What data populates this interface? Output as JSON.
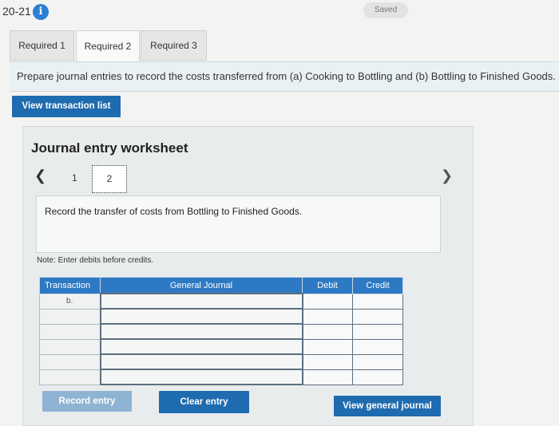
{
  "header": {
    "question_number": "20-21",
    "saved_label": "Saved"
  },
  "tabs": [
    {
      "label": "Required 1",
      "active": false
    },
    {
      "label": "Required 2",
      "active": true
    },
    {
      "label": "Required 3",
      "active": false
    }
  ],
  "instruction": "Prepare journal entries to record the costs transferred from (a) Cooking to Bottling and (b) Bottling to Finished Goods.",
  "view_transaction_list_label": "View transaction list",
  "worksheet": {
    "title": "Journal entry worksheet",
    "pages": [
      "1",
      "2"
    ],
    "current_page": "2",
    "description": "Record the transfer of costs from Bottling to Finished Goods.",
    "note": "Note: Enter debits before credits.",
    "table": {
      "headers": [
        "Transaction",
        "General Journal",
        "Debit",
        "Credit"
      ],
      "rows": [
        {
          "transaction": "b.",
          "account": "",
          "debit": "",
          "credit": ""
        },
        {
          "transaction": "",
          "account": "",
          "debit": "",
          "credit": ""
        },
        {
          "transaction": "",
          "account": "",
          "debit": "",
          "credit": ""
        },
        {
          "transaction": "",
          "account": "",
          "debit": "",
          "credit": ""
        },
        {
          "transaction": "",
          "account": "",
          "debit": "",
          "credit": ""
        },
        {
          "transaction": "",
          "account": "",
          "debit": "",
          "credit": ""
        }
      ]
    }
  },
  "buttons": {
    "record_entry": "Record entry",
    "clear_entry": "Clear entry",
    "view_general_journal": "View general journal"
  },
  "icons": {
    "info": "info-icon",
    "prev": "chevron-left-icon",
    "next": "chevron-right-icon"
  },
  "colors": {
    "primary": "#1f6bb0",
    "table_header": "#2e79c3",
    "info": "#2a7fd4"
  }
}
